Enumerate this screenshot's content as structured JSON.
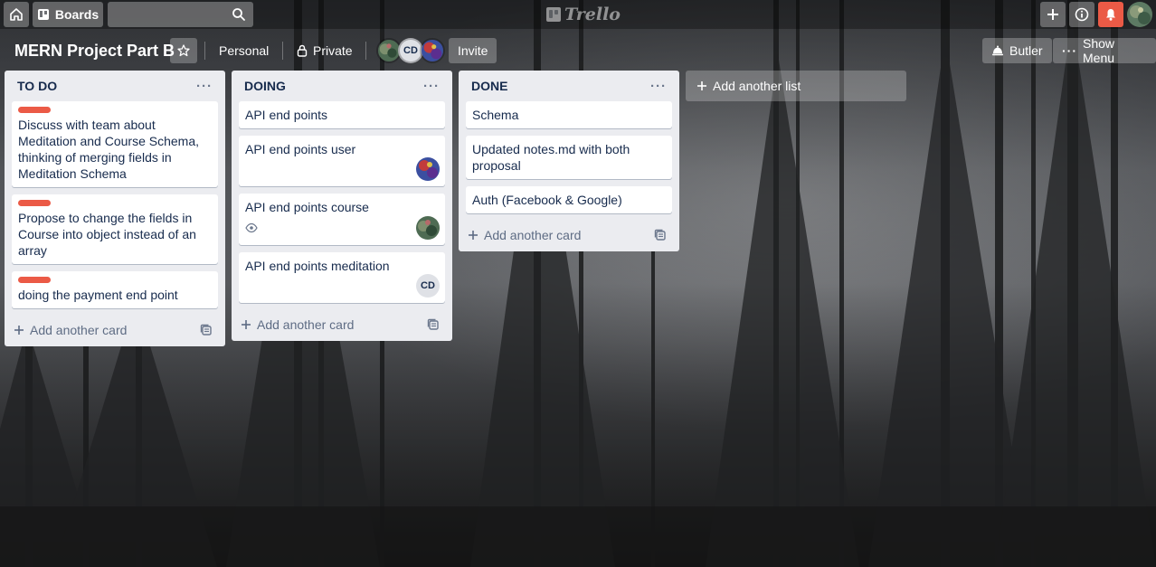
{
  "nav": {
    "boards_label": "Boards",
    "search_placeholder": "",
    "logo_text": "Trello",
    "bell_color": "#eb5a46"
  },
  "board": {
    "title": "MERN Project Part B",
    "team_label": "Personal",
    "visibility_label": "Private",
    "invite_label": "Invite",
    "butler_label": "Butler",
    "show_menu_label": "Show Menu",
    "member_initials": "CD"
  },
  "lists": [
    {
      "title": "TO DO",
      "cards": [
        {
          "text": "Discuss with team about Meditation and Course Schema, thinking of merging fields in Meditation Schema",
          "label_color": "#eb5a46"
        },
        {
          "text": "Propose to change the fields in Course into object instead of an array",
          "label_color": "#eb5a46"
        },
        {
          "text": "doing the payment end point",
          "label_color": "#eb5a46"
        }
      ],
      "add_card_label": "Add another card"
    },
    {
      "title": "DOING",
      "cards": [
        {
          "text": "API end points"
        },
        {
          "text": "API end points user"
        },
        {
          "text": "API end points course"
        },
        {
          "text": "API end points meditation",
          "member_initials": "CD"
        }
      ],
      "add_card_label": "Add another card"
    },
    {
      "title": "DONE",
      "cards": [
        {
          "text": "Schema"
        },
        {
          "text": "Updated notes.md with both proposal"
        },
        {
          "text": "Auth (Facebook & Google)"
        }
      ],
      "add_card_label": "Add another card"
    }
  ],
  "add_list_label": "Add another list",
  "list_menu_glyph": "···"
}
